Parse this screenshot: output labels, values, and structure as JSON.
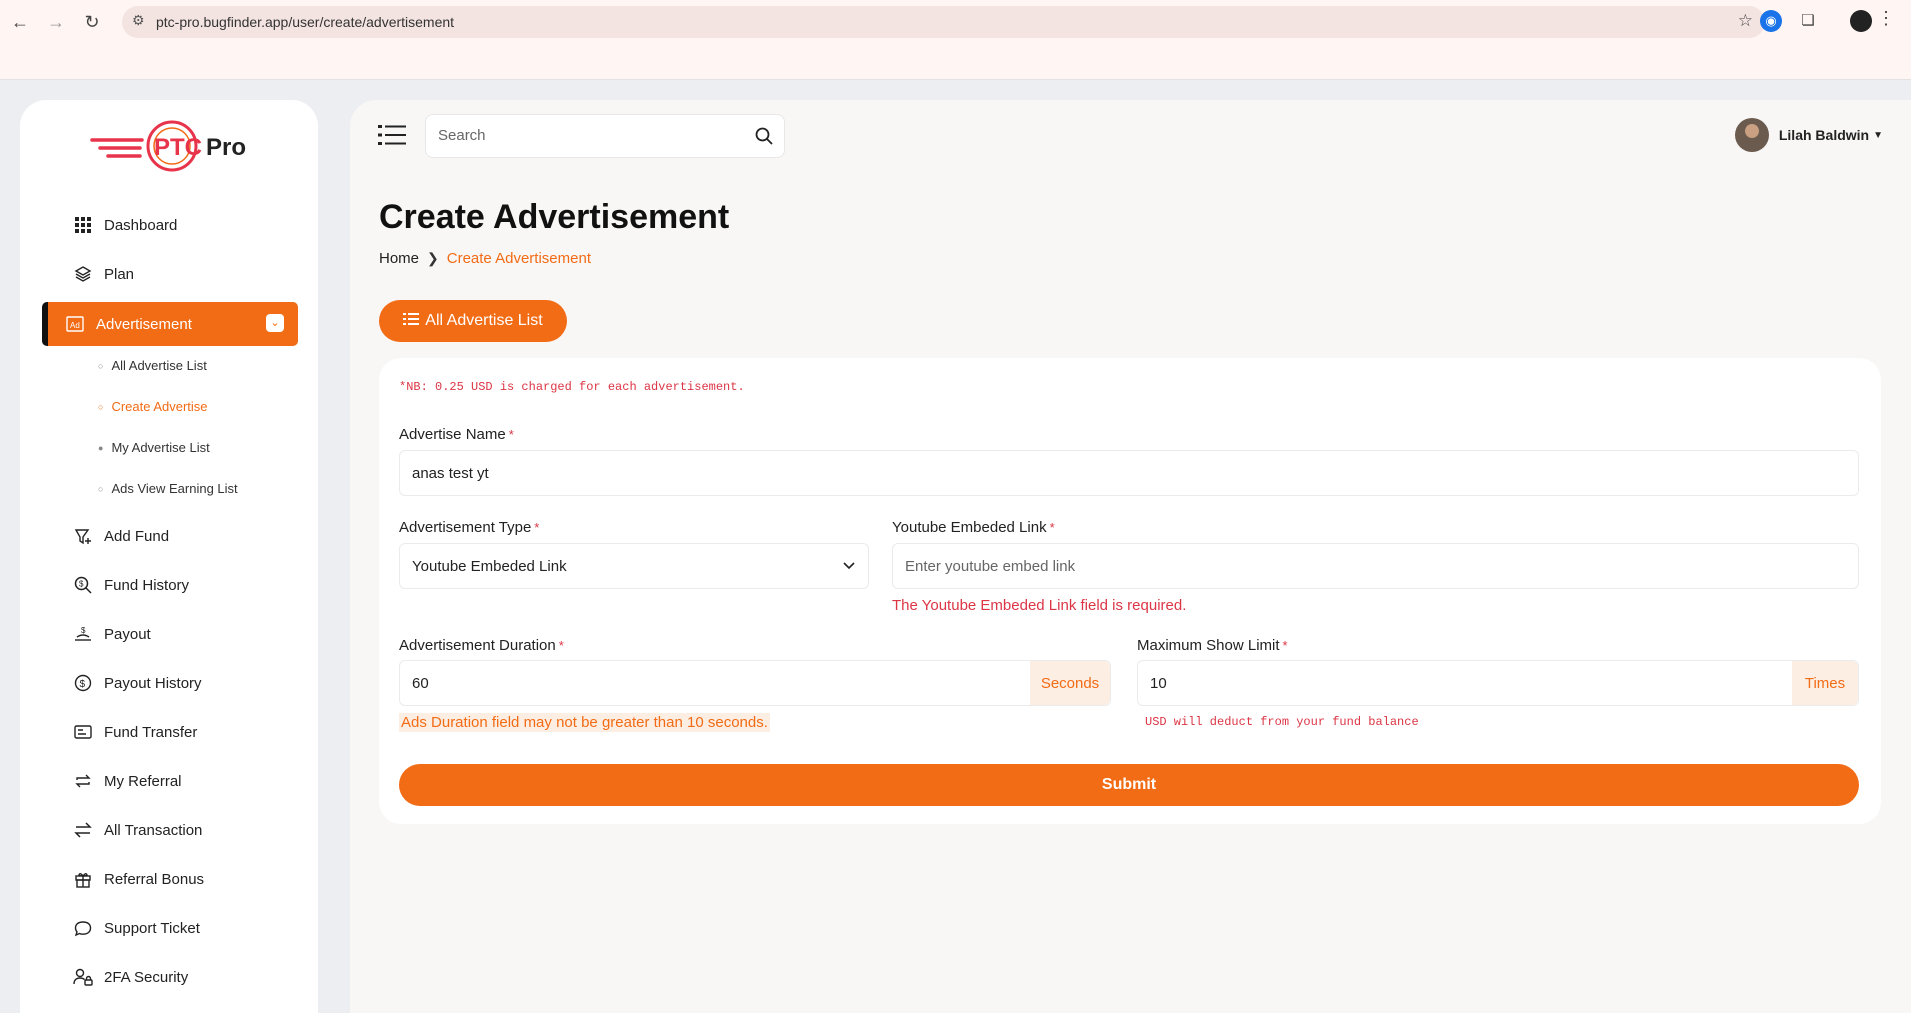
{
  "browser": {
    "url": "ptc-pro.bugfinder.app/user/create/advertisement"
  },
  "sidebar": {
    "logo_text": "PTCPro",
    "items": [
      {
        "label": "Dashboard",
        "icon": "grid-icon"
      },
      {
        "label": "Plan",
        "icon": "layers-icon"
      },
      {
        "label": "Advertisement",
        "icon": "ad-icon"
      },
      {
        "label": "Add Fund",
        "icon": "add-fund-icon"
      },
      {
        "label": "Fund History",
        "icon": "search-money-icon"
      },
      {
        "label": "Payout",
        "icon": "payout-icon"
      },
      {
        "label": "Payout History",
        "icon": "dollar-circle-icon"
      },
      {
        "label": "Fund Transfer",
        "icon": "card-icon"
      },
      {
        "label": "My Referral",
        "icon": "repeat-icon"
      },
      {
        "label": "All Transaction",
        "icon": "exchange-icon"
      },
      {
        "label": "Referral Bonus",
        "icon": "gift-icon"
      },
      {
        "label": "Support Ticket",
        "icon": "chat-icon"
      },
      {
        "label": "2FA Security",
        "icon": "users-lock-icon"
      }
    ],
    "sub_items": [
      {
        "label": "All Advertise List"
      },
      {
        "label": "Create Advertise"
      },
      {
        "label": "My Advertise List"
      },
      {
        "label": "Ads View Earning List"
      }
    ]
  },
  "header": {
    "search_placeholder": "Search",
    "user_name": "Lilah Baldwin"
  },
  "page": {
    "title": "Create Advertisement",
    "breadcrumb_home": "Home",
    "breadcrumb_current": "Create Advertisement",
    "list_button": "All Advertise List"
  },
  "form": {
    "note": "*NB: 0.25 USD is charged for each advertisement.",
    "required_mark": "*",
    "name_label": "Advertise Name",
    "name_value": "anas test yt",
    "type_label": "Advertisement Type",
    "type_value": "Youtube Embeded Link",
    "link_label": "Youtube Embeded Link",
    "link_placeholder": "Enter youtube embed link",
    "link_error": "The Youtube Embeded Link field is required.",
    "duration_label": "Advertisement Duration",
    "duration_value": "60",
    "duration_unit": "Seconds",
    "duration_error": "Ads Duration field may not be greater than 10 seconds.",
    "limit_label": "Maximum Show Limit",
    "limit_value": "10",
    "limit_unit": "Times",
    "limit_hint": "USD will deduct from your fund balance",
    "submit": "Submit"
  },
  "colors": {
    "accent": "#f26b15",
    "error": "#dc3545"
  }
}
